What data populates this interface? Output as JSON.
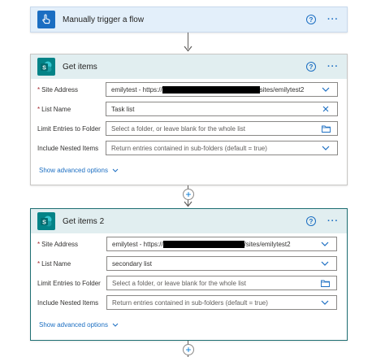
{
  "trigger": {
    "title": "Manually trigger a flow",
    "icon": "hand-touch-icon",
    "accent": "#1b6ec2"
  },
  "get_items": {
    "title": "Get items",
    "icon": "sharepoint-icon",
    "accent": "#038387",
    "site_address": {
      "label": "Site Address",
      "value_prefix": "emilytest - https://",
      "value_suffix": "sites/emilytest2"
    },
    "list_name": {
      "label": "List Name",
      "value": "Task list"
    },
    "limit_entries": {
      "label": "Limit Entries to Folder",
      "placeholder": "Select a folder, or leave blank for the whole list"
    },
    "include_nested": {
      "label": "Include Nested Items",
      "placeholder": "Return entries contained in sub-folders (default = true)"
    },
    "show_advanced": "Show advanced options"
  },
  "get_items_2": {
    "title": "Get items 2",
    "icon": "sharepoint-icon",
    "accent": "#038387",
    "site_address": {
      "label": "Site Address",
      "value_prefix": "emilytest - https://",
      "value_suffix": "/sites/emilytest2"
    },
    "list_name": {
      "label": "List Name",
      "value": "secondary list"
    },
    "limit_entries": {
      "label": "Limit Entries to Folder",
      "placeholder": "Select a folder, or leave blank for the whole list"
    },
    "include_nested": {
      "label": "Include Nested Items",
      "placeholder": "Return entries contained in sub-folders (default = true)"
    },
    "show_advanced": "Show advanced options"
  },
  "common": {
    "help_glyph": "?",
    "more_glyph": "···",
    "required_mark": "*",
    "add_glyph": "+"
  }
}
